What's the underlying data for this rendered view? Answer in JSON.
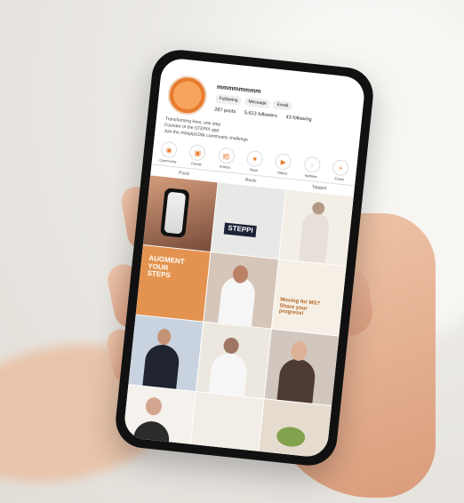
{
  "photo": {
    "subject": "hand-holding-phone",
    "colors": {
      "background": "#efeeea",
      "skin": "#e3b08f",
      "phone_body": "#111111",
      "accent": "#e87c2e"
    }
  },
  "instagram": {
    "username": "mmmmmmmm",
    "buttons": [
      "Following",
      "Message",
      "Email"
    ],
    "stats": [
      "287 posts",
      "5,613 followers",
      "43 following"
    ],
    "bio": [
      "Transforming lives, one step",
      "Founder of the STEPPI app",
      "Join the #Steppi100k community challenge"
    ],
    "highlights": [
      {
        "label": "Community",
        "icon": "person"
      },
      {
        "label": "Events",
        "icon": "calendar"
      },
      {
        "label": "Articles",
        "icon": "article"
      },
      {
        "label": "Steps",
        "icon": "heart"
      },
      {
        "label": "Videos",
        "icon": "play"
      },
      {
        "label": "Updates",
        "icon": "bell"
      },
      {
        "label": "Extras",
        "icon": "plus"
      }
    ],
    "tabs": [
      "Posts",
      "Reels",
      "Tagged"
    ],
    "tiles": [
      {
        "text": "",
        "color": "#d49c7b"
      },
      {
        "text": "STEPPI",
        "color": "#e8e8e6"
      },
      {
        "text": "",
        "color": "#f3efe7"
      },
      {
        "text": "AUGMENT YOUR STEPS",
        "color": "#e3934f"
      },
      {
        "text": "",
        "color": "#d6c6ba"
      },
      {
        "text": "Moving for MS? Share your progress!",
        "color": "#f6efe5"
      },
      {
        "text": "",
        "color": "#c9d3df"
      },
      {
        "text": "",
        "color": "#ece7df"
      },
      {
        "text": "",
        "color": "#d1c7bf"
      },
      {
        "text": "",
        "color": "#f5f1ec"
      },
      {
        "text": "",
        "color": "#f2ede6"
      },
      {
        "text": "",
        "color": "#e5dccf"
      }
    ]
  }
}
